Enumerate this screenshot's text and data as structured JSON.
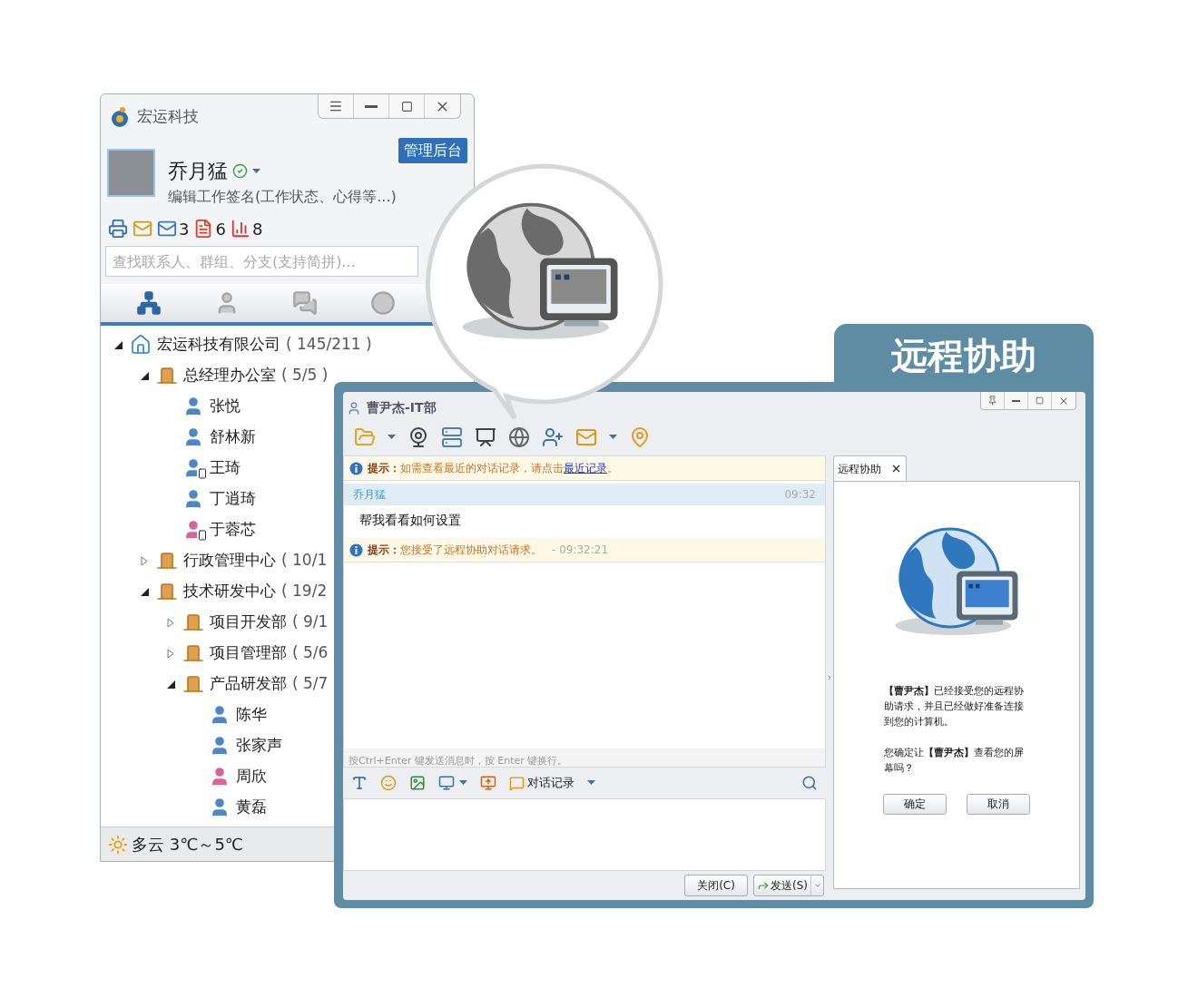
{
  "main_window": {
    "title": "宏运科技",
    "admin_button": "管理后台",
    "user": {
      "name": "乔月猛",
      "signature": "编辑工作签名(工作状态、心得等...)"
    },
    "counters": [
      {
        "kind": "mail",
        "count": "3"
      },
      {
        "kind": "card",
        "count": "6"
      },
      {
        "kind": "chart",
        "count": "8"
      }
    ],
    "search": {
      "placeholder": "查找联系人、群组、分支(支持简拼)..."
    },
    "tabs": [
      {
        "kind": "organization",
        "selected": true
      },
      {
        "kind": "contacts",
        "selected": false
      },
      {
        "kind": "groups",
        "selected": false
      },
      {
        "kind": "recent",
        "selected": false
      }
    ],
    "tree": [
      {
        "kind": "company",
        "label": "宏运科技有限公司",
        "count": "( 145/211 )",
        "expanded": true,
        "children": [
          {
            "kind": "department",
            "label": "总经理办公室",
            "count": "( 5/5 )",
            "expanded": true,
            "children": [
              {
                "kind": "person",
                "label": "张悦",
                "female": false,
                "mobile": false
              },
              {
                "kind": "person",
                "label": "舒林新",
                "female": false,
                "mobile": false
              },
              {
                "kind": "person",
                "label": "王琦",
                "female": false,
                "mobile": true
              },
              {
                "kind": "person",
                "label": "丁逍琦",
                "female": false,
                "mobile": false
              },
              {
                "kind": "person",
                "label": "于蓉芯",
                "female": true,
                "mobile": true
              }
            ]
          },
          {
            "kind": "department",
            "label": "行政管理中心",
            "count": "( 10/1",
            "expanded": false
          },
          {
            "kind": "department",
            "label": "技术研发中心",
            "count": "( 19/2",
            "expanded": true,
            "children": [
              {
                "kind": "department",
                "label": "项目开发部",
                "count": "( 9/1",
                "expanded": false
              },
              {
                "kind": "department",
                "label": "项目管理部",
                "count": "( 5/6",
                "expanded": false
              },
              {
                "kind": "department",
                "label": "产品研发部",
                "count": "( 5/7",
                "expanded": true,
                "children": [
                  {
                    "kind": "person",
                    "label": "陈华",
                    "female": false,
                    "mobile": false
                  },
                  {
                    "kind": "person",
                    "label": "张家声",
                    "female": false,
                    "mobile": false
                  },
                  {
                    "kind": "person",
                    "label": "周欣",
                    "female": true,
                    "mobile": false
                  },
                  {
                    "kind": "person",
                    "label": "黄磊",
                    "female": false,
                    "mobile": false
                  }
                ]
              }
            ]
          }
        ]
      }
    ],
    "weather": "多云 3℃～5℃"
  },
  "banner": "远程协助",
  "chat_window": {
    "title": "曹尹杰-IT部",
    "messages": [
      {
        "kind": "notice",
        "text": "**提示：**如需查看最近的对话记录，请点击",
        "link": "最近记录",
        "tail": "。"
      },
      {
        "kind": "message",
        "sender": "乔月猛",
        "time": "09:32",
        "text": "帮我看看如何设置"
      },
      {
        "kind": "notice",
        "text": "**提示：**您接受了远程协助对话请求。",
        "time": "- 09:32:21"
      }
    ],
    "input_hint": "按Ctrl+Enter 键发送消息时，按 Enter 键换行。",
    "history_button": "对话记录",
    "close_button": "关闭(C)",
    "send_button": "发送(S)",
    "side_panel": {
      "tab": "远程协助",
      "message": "**【曹尹杰】**已经接受您的远程协助请求，并且已经做好准备连接到您的计算机。",
      "question": "您确定让**【曹尹杰】**查看您的屏幕吗？",
      "confirm": "确定",
      "cancel": "取消"
    }
  }
}
